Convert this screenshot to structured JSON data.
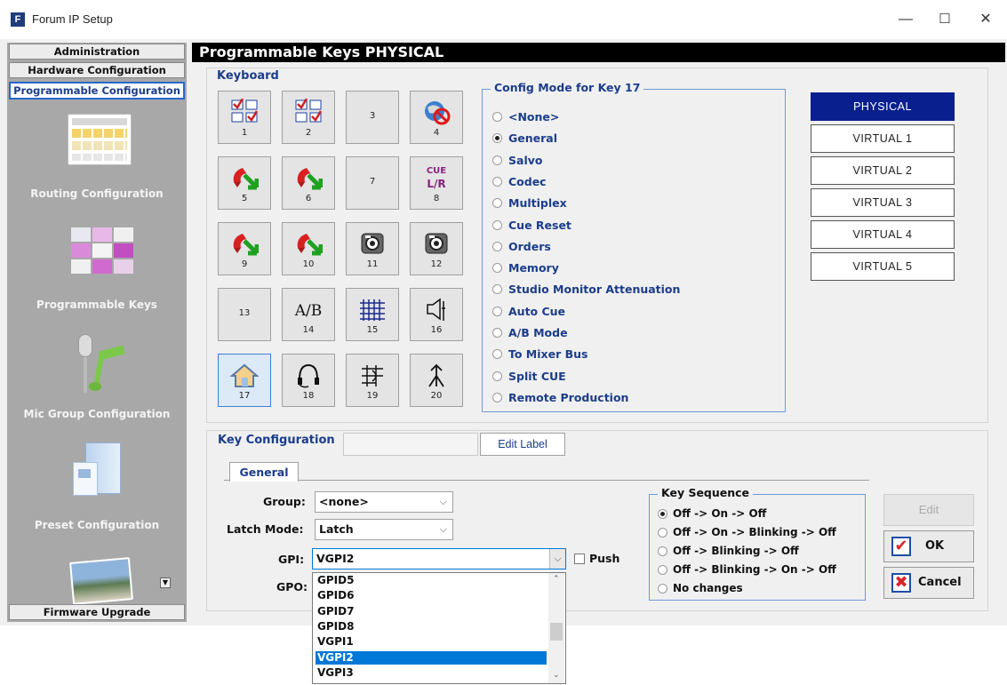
{
  "window": {
    "title": "Forum IP Setup",
    "app_letter": "F",
    "min": "—",
    "max": "☐",
    "close": "✕"
  },
  "nav": {
    "administration": "Administration",
    "hardware": "Hardware Configuration",
    "programmable": "Programmable Configuration",
    "routing": "Routing Configuration",
    "keys": "Programmable Keys",
    "mic": "Mic Group Configuration",
    "preset": "Preset Configuration",
    "firmware": "Firmware Upgrade"
  },
  "main": {
    "title": "Programmable Keys PHYSICAL",
    "keyboard_label": "Keyboard"
  },
  "keys": [
    {
      "num": "1",
      "icon": "checklist-icon"
    },
    {
      "num": "2",
      "icon": "checklist-icon"
    },
    {
      "num": "3",
      "icon": ""
    },
    {
      "num": "4",
      "icon": "no-globe-icon"
    },
    {
      "num": "5",
      "icon": "phone-icon"
    },
    {
      "num": "6",
      "icon": "phone-icon"
    },
    {
      "num": "7",
      "icon": ""
    },
    {
      "num": "8",
      "icon": "cue-lr-icon"
    },
    {
      "num": "9",
      "icon": "phone-icon"
    },
    {
      "num": "10",
      "icon": "phone-icon"
    },
    {
      "num": "11",
      "icon": "camera-icon"
    },
    {
      "num": "12",
      "icon": "camera-icon"
    },
    {
      "num": "13",
      "icon": ""
    },
    {
      "num": "14",
      "icon": "ab-icon"
    },
    {
      "num": "15",
      "icon": "grid-icon"
    },
    {
      "num": "16",
      "icon": "speaker-icon"
    },
    {
      "num": "17",
      "icon": "home-icon"
    },
    {
      "num": "18",
      "icon": "headset-icon"
    },
    {
      "num": "19",
      "icon": "routing-icon"
    },
    {
      "num": "20",
      "icon": "arrows-up-icon"
    }
  ],
  "cue_text": "CUE",
  "lr_text": "L/R",
  "ab_text": "A/B",
  "config_mode": {
    "title": "Config Mode for Key 17",
    "selected": 1,
    "options": [
      "<None>",
      "General",
      "Salvo",
      "Codec",
      "Multiplex",
      "Cue Reset",
      "Orders",
      "Memory",
      "Studio Monitor Attenuation",
      "Auto Cue",
      "A/B Mode",
      "To Mixer Bus",
      "Split CUE",
      "Remote Production"
    ]
  },
  "pages": [
    "PHYSICAL",
    "VIRTUAL 1",
    "VIRTUAL 2",
    "VIRTUAL 3",
    "VIRTUAL 4",
    "VIRTUAL 5"
  ],
  "key_config": {
    "title": "Key Configuration",
    "label_value": "",
    "edit_label": "Edit Label",
    "tab": "General",
    "group_label": "Group:",
    "group_value": "<none>",
    "latch_label": "Latch Mode:",
    "latch_value": "Latch",
    "gpi_label": "GPI:",
    "gpi_value": "VGPI2",
    "gpo_label": "GPO:",
    "push_label": "Push"
  },
  "key_sequence": {
    "title": "Key Sequence",
    "selected": 0,
    "options": [
      "Off -> On -> Off",
      "Off -> On -> Blinking -> Off",
      "Off -> Blinking -> Off",
      "Off -> Blinking -> On -> Off",
      "No changes"
    ]
  },
  "actions": {
    "edit": "Edit",
    "ok": "OK",
    "cancel": "Cancel"
  },
  "dropdown": {
    "items": [
      "GPID5",
      "GPID6",
      "GPID7",
      "GPID8",
      "VGPI1",
      "VGPI2",
      "VGPI3"
    ],
    "selected": 5
  }
}
